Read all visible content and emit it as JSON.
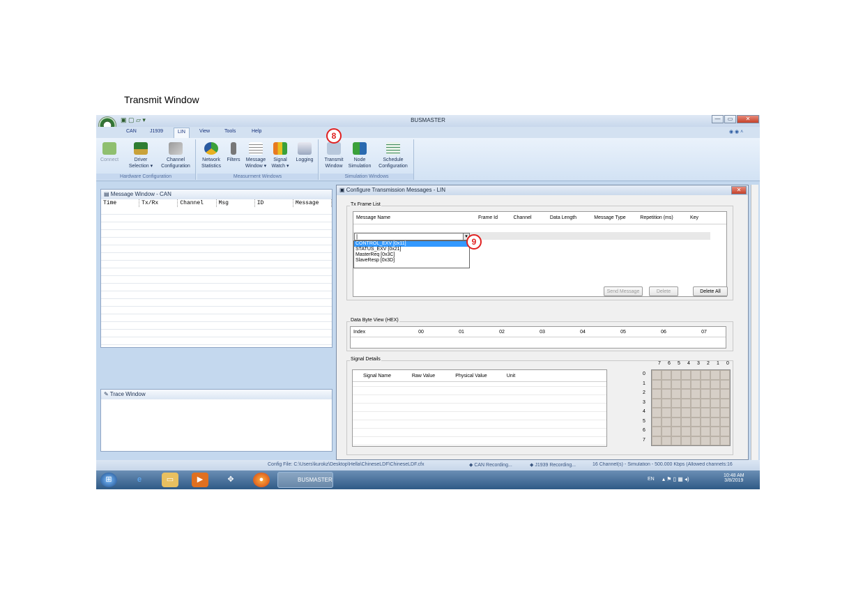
{
  "document": {
    "title": "Transmit Window"
  },
  "app": {
    "title": "BUSMASTER"
  },
  "window_controls": {
    "minimize": "—",
    "restore": "▭",
    "close": "✕"
  },
  "tabs": [
    "CAN",
    "J1939",
    "LIN",
    "View",
    "Tools",
    "Help"
  ],
  "ribbon": {
    "hw_group": "Hardware Configuration",
    "meas_group": "Measurment Windows",
    "sim_group": "Simulation Windows",
    "connect": "Connect",
    "driver": [
      "Driver",
      "Selection ▾"
    ],
    "channel": [
      "Channel",
      "Configuration"
    ],
    "network": [
      "Network",
      "Statistics"
    ],
    "filters": "Filters",
    "message": [
      "Message",
      "Window ▾"
    ],
    "signal": [
      "Signal",
      "Watch ▾"
    ],
    "logging": "Logging",
    "transmit": [
      "Transmit",
      "Window"
    ],
    "node": [
      "Node",
      "Simulation"
    ],
    "schedule": [
      "Schedule",
      "Configuration"
    ]
  },
  "callouts": {
    "c8": "8",
    "c9": "9"
  },
  "message_window": {
    "title": "Message Window - CAN",
    "columns": [
      "Time",
      "Tx/Rx",
      "Channel",
      "Msg",
      "ID",
      "Message"
    ]
  },
  "trace_window": {
    "title": "Trace Window"
  },
  "dialog": {
    "title": "Configure Transmission Messages - LIN",
    "tx_frame_list": "Tx Frame List",
    "frame_columns": [
      "Message Name",
      "Frame Id",
      "Channel",
      "Data Length",
      "Message Type",
      "Repetition (ms)",
      "Key"
    ],
    "dropdown_options": [
      "CONTROL_EXV [0x11]",
      "STATUS_EXV [0x21]",
      "MasterReq [0x3C]",
      "SlaveResp [0x3D]"
    ],
    "buttons": {
      "send": "Send Message",
      "delete": "Delete",
      "delete_all": "Delete All"
    },
    "data_byte_view": "Data Byte View (HEX)",
    "byte_columns": [
      "Index",
      "00",
      "01",
      "02",
      "03",
      "04",
      "05",
      "06",
      "07"
    ],
    "signal_details": "Signal Details",
    "signal_columns": [
      "Signal Name",
      "Raw Value",
      "Physical Value",
      "Unit"
    ],
    "bit_header": [
      "7",
      "6",
      "5",
      "4",
      "3",
      "2",
      "1",
      "0"
    ],
    "byte_rows": [
      "0",
      "1",
      "2",
      "3",
      "4",
      "5",
      "6",
      "7"
    ]
  },
  "status_bar": {
    "config": "Config File: C:\\Users\\kurokz\\Desktop\\Hella\\ChineseLDF\\ChineseLDF.cfx",
    "can": "CAN Recording...",
    "j1939": "J1939 Recording...",
    "channels": "16 Channel(s) - Simulation - 500.000 Kbps (Allowed channels:16"
  },
  "taskbar": {
    "app": "BUSMASTER",
    "lang": "EN",
    "time": "10:48 AM",
    "date": "3/8/2019"
  },
  "colors": {
    "accent": "#e02020",
    "selection": "#3399ff",
    "ribbon": "#d2e2f4"
  }
}
